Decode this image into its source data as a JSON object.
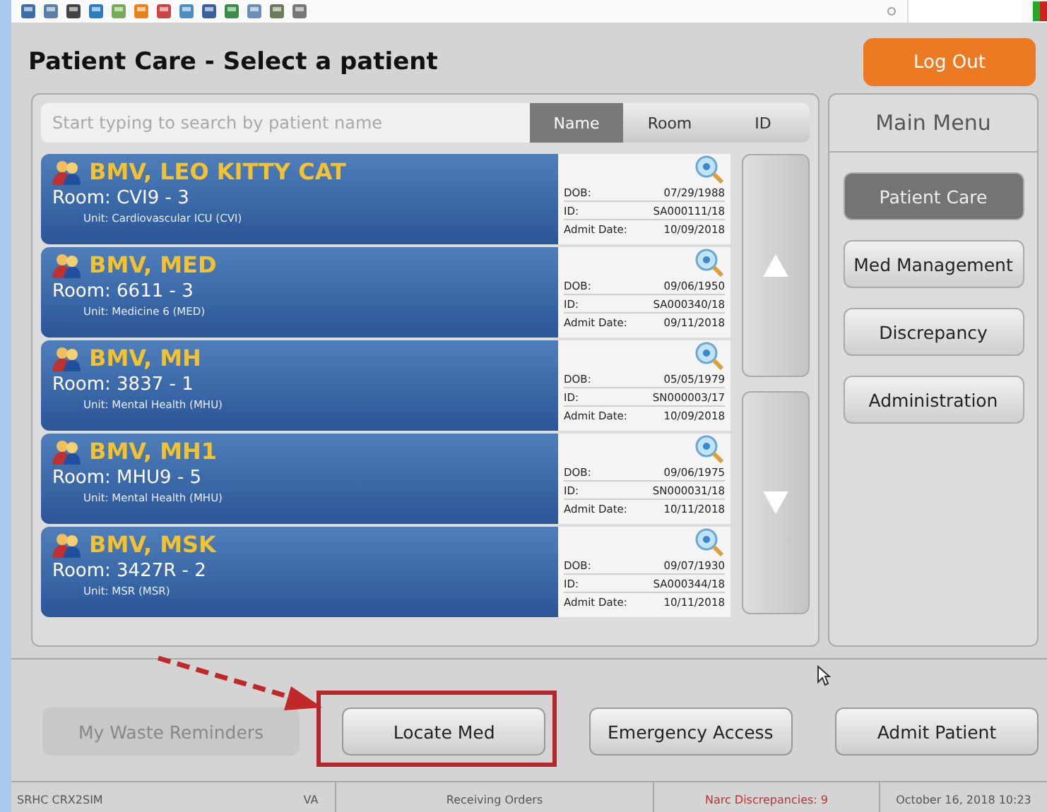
{
  "title": "Patient Care - Select a patient",
  "logout": "Log Out",
  "search": {
    "placeholder": "Start typing to search by patient name"
  },
  "search_tabs": [
    {
      "label": "Name",
      "selected": true
    },
    {
      "label": "Room",
      "selected": false
    },
    {
      "label": "ID",
      "selected": false
    }
  ],
  "patients": [
    {
      "name": "BMV, LEO KITTY CAT",
      "room": "Room: CVI9 - 3",
      "unit": "Unit: Cardiovascular ICU (CVI)",
      "dob_label": "DOB:",
      "dob": "07/29/1988",
      "id_label": "ID:",
      "id": "SA000111/18",
      "admit_label": "Admit Date:",
      "admit": "10/09/2018"
    },
    {
      "name": "BMV, MED",
      "room": "Room: 6611 - 3",
      "unit": "Unit: Medicine 6 (MED)",
      "dob_label": "DOB:",
      "dob": "09/06/1950",
      "id_label": "ID:",
      "id": "SA000340/18",
      "admit_label": "Admit Date:",
      "admit": "09/11/2018"
    },
    {
      "name": "BMV, MH",
      "room": "Room: 3837 - 1",
      "unit": "Unit: Mental Health (MHU)",
      "dob_label": "DOB:",
      "dob": "05/05/1979",
      "id_label": "ID:",
      "id": "SN000003/17",
      "admit_label": "Admit Date:",
      "admit": "10/09/2018"
    },
    {
      "name": "BMV, MH1",
      "room": "Room: MHU9 - 5",
      "unit": "Unit: Mental Health (MHU)",
      "dob_label": "DOB:",
      "dob": "09/06/1975",
      "id_label": "ID:",
      "id": "SN000031/18",
      "admit_label": "Admit Date:",
      "admit": "10/11/2018"
    },
    {
      "name": "BMV, MSK",
      "room": "Room: 3427R - 2",
      "unit": "Unit: MSR (MSR)",
      "dob_label": "DOB:",
      "dob": "09/07/1930",
      "id_label": "ID:",
      "id": "SA000344/18",
      "admit_label": "Admit Date:",
      "admit": "10/11/2018"
    }
  ],
  "main_menu": {
    "title": "Main Menu",
    "items": [
      {
        "label": "Patient Care",
        "selected": true
      },
      {
        "label": "Med Management",
        "selected": false
      },
      {
        "label": "Discrepancy",
        "selected": false
      },
      {
        "label": "Administration",
        "selected": false
      }
    ]
  },
  "actions": [
    {
      "label": "My Waste Reminders",
      "disabled": true,
      "highlighted": false
    },
    {
      "label": "Locate Med",
      "disabled": false,
      "highlighted": true
    },
    {
      "label": "Emergency Access",
      "disabled": false,
      "highlighted": false
    },
    {
      "label": "Admit Patient",
      "disabled": false,
      "highlighted": false
    }
  ],
  "status_bar": [
    {
      "text": "SRHC CRX2SIM",
      "kind": "plain"
    },
    {
      "text": "VA",
      "kind": "plain"
    },
    {
      "text": "Receiving Orders",
      "kind": "center"
    },
    {
      "text": "Narc Discrepancies: 9",
      "kind": "alert"
    },
    {
      "text": "October 16, 2018  10:23",
      "kind": "center"
    }
  ]
}
